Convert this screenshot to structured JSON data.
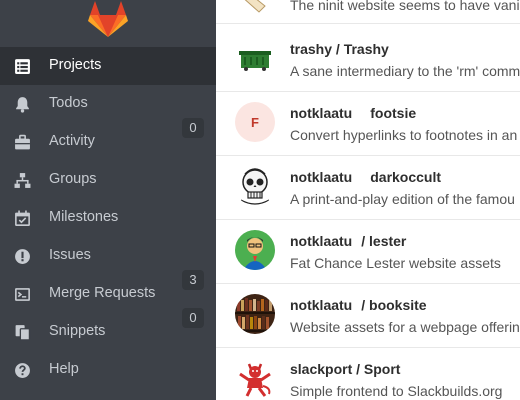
{
  "sidebar": {
    "logo": "gitlab-tanuki-logo",
    "items": [
      {
        "label": "Projects",
        "icon": "projects-icon",
        "active": true
      },
      {
        "label": "Todos",
        "icon": "bell-icon"
      },
      {
        "label": "Activity",
        "icon": "briefcase-icon",
        "count": "0"
      },
      {
        "label": "Groups",
        "icon": "groups-icon"
      },
      {
        "label": "Milestones",
        "icon": "calendar-check-icon"
      },
      {
        "label": "Issues",
        "icon": "exclamation-circle-icon"
      },
      {
        "label": "Merge Requests",
        "icon": "terminal-icon",
        "count": "3"
      },
      {
        "label": "Snippets",
        "icon": "copy-icon",
        "count": "0"
      },
      {
        "label": "Help",
        "icon": "question-circle-icon"
      }
    ]
  },
  "projects": [
    {
      "title": "",
      "description": "The ninit website seems to have vanis",
      "avatar": "scroll-image"
    },
    {
      "title": "trashy / Trashy",
      "description": "A sane intermediary to the 'rm' comm",
      "avatar": "dumpster-image"
    },
    {
      "namespace": "notklaatu",
      "name": "footsie",
      "description": "Convert hyperlinks to footnotes in an",
      "avatar": "letter-avatar",
      "avatar_letter": "F"
    },
    {
      "namespace": "notklaatu",
      "name": "darkoccult",
      "description": "A print-and-play edition of the famou",
      "avatar": "skull-image"
    },
    {
      "namespace": "notklaatu",
      "name": "/ lester",
      "description": "Fat Chance Lester website assets",
      "avatar": "cartoon-man-image"
    },
    {
      "namespace": "notklaatu",
      "name": "/ booksite",
      "description": "Website assets for a webpage offering",
      "avatar": "bookshelf-image"
    },
    {
      "title": "slackport / Sport",
      "description": "Simple frontend to Slackbuilds.org",
      "avatar": "red-devil-image"
    }
  ]
}
